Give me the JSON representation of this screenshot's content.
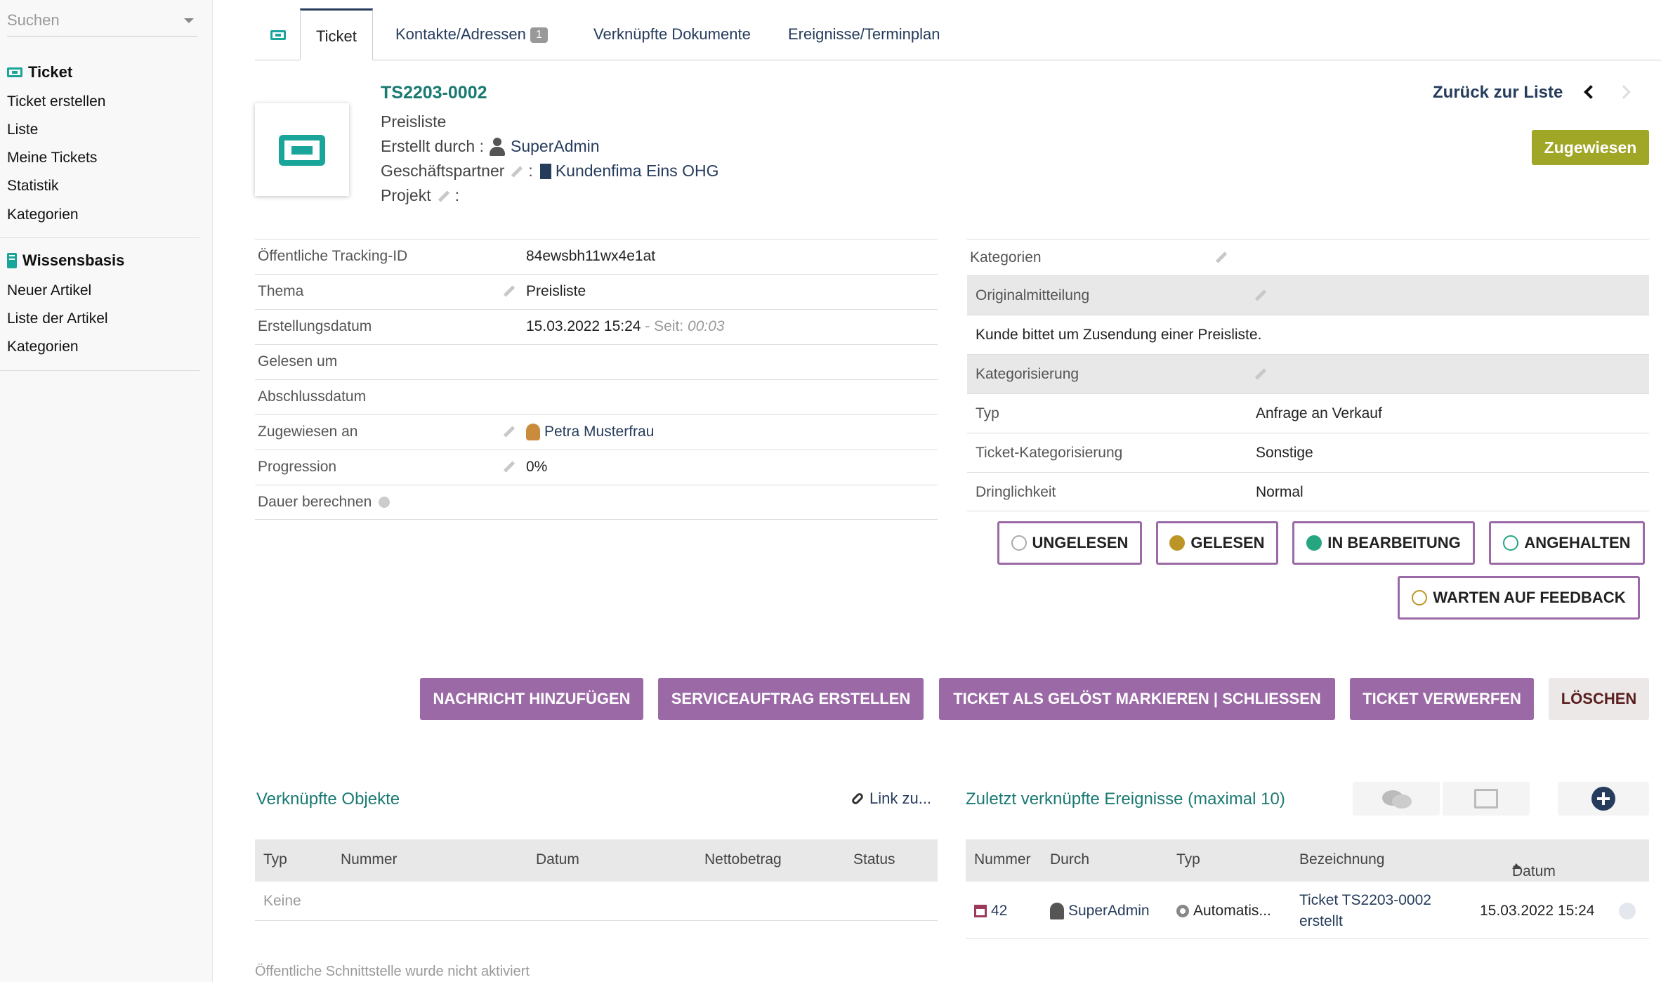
{
  "sidebar": {
    "search_placeholder": "Suchen",
    "ticket_heading": "Ticket",
    "ticket_items": [
      "Ticket erstellen",
      "Liste",
      "Meine Tickets",
      "Statistik",
      "Kategorien"
    ],
    "kb_heading": "Wissensbasis",
    "kb_items": [
      "Neuer Artikel",
      "Liste der Artikel",
      "Kategorien"
    ]
  },
  "tabs": {
    "ticket": "Ticket",
    "contacts": "Kontakte/Adressen",
    "contacts_count": "1",
    "docs": "Verknüpfte Dokumente",
    "events": "Ereignisse/Terminplan"
  },
  "header": {
    "ref": "TS2203-0002",
    "subject": "Preisliste",
    "created_by_label": "Erstellt durch :",
    "created_by": "SuperAdmin",
    "partner_label": "Geschäftspartner",
    "partner_sep": ":",
    "partner": "Kundenfima Eins OHG",
    "project_label": "Projekt",
    "project_sep": ":",
    "back_link": "Zurück zur Liste",
    "status_badge": "Zugewiesen"
  },
  "details": [
    {
      "label": "Öffentliche Tracking-ID",
      "value": "84ewsbh11wx4e1at"
    },
    {
      "label": "Thema",
      "value": "Preisliste"
    },
    {
      "label": "Erstellungsdatum",
      "value": "15.03.2022 15:24",
      "extra_label": " - Seit: ",
      "extra_value": "00:03"
    },
    {
      "label": "Gelesen um",
      "value": ""
    },
    {
      "label": "Abschlussdatum",
      "value": ""
    },
    {
      "label": "Zugewiesen an",
      "value": "Petra Musterfrau"
    },
    {
      "label": "Progression",
      "value": "0%"
    },
    {
      "label": "Dauer berechnen",
      "value": ""
    }
  ],
  "right_panel": {
    "categories_label": "Kategorien",
    "original_label": "Originalmitteilung",
    "original_text": "Kunde bittet um Zusendung einer Preisliste.",
    "categorization_label": "Kategorisierung",
    "rows": [
      {
        "label": "Typ",
        "value": "Anfrage an Verkauf"
      },
      {
        "label": "Ticket-Kategorisierung",
        "value": "Sonstige"
      },
      {
        "label": "Dringlichkeit",
        "value": "Normal"
      }
    ]
  },
  "status_buttons": [
    "UNGELESEN",
    "GELESEN",
    "IN BEARBEITUNG",
    "ANGEHALTEN",
    "WARTEN AUF FEEDBACK"
  ],
  "status_colors": {
    "unread": "#ffffff",
    "read": "#bc9526",
    "in_progress": "#25a580",
    "paused": "#ffffff",
    "feedback": "#ffffff"
  },
  "actions": [
    "NACHRICHT HINZUFÜGEN",
    "SERVICEAUFTRAG ERSTELLEN",
    "TICKET ALS GELÖST MARKIEREN | SCHLIESSEN",
    "TICKET VERWERFEN",
    "LÖSCHEN"
  ],
  "linked_objects": {
    "title": "Verknüpfte Objekte",
    "link_label": "Link zu...",
    "columns": [
      "Typ",
      "Nummer",
      "Datum",
      "Nettobetrag",
      "Status"
    ],
    "empty": "Keine"
  },
  "events": {
    "title": "Zuletzt verknüpfte Ereignisse (maximal 10)",
    "columns": [
      "Nummer",
      "Durch",
      "Typ",
      "Bezeichnung",
      "Datum"
    ],
    "rows": [
      {
        "number": "42",
        "by": "SuperAdmin",
        "type": "Automatis...",
        "label_line1": "Ticket TS2203-0002",
        "label_line2": "erstellt",
        "date": "15.03.2022 15:24"
      }
    ]
  },
  "footer_note": "Öffentliche Schnittstelle wurde nicht aktiviert",
  "colors": {
    "accent": "#1aa59a",
    "link": "#263c5c",
    "action": "#9b6aa6",
    "badge": "#a0a626"
  }
}
